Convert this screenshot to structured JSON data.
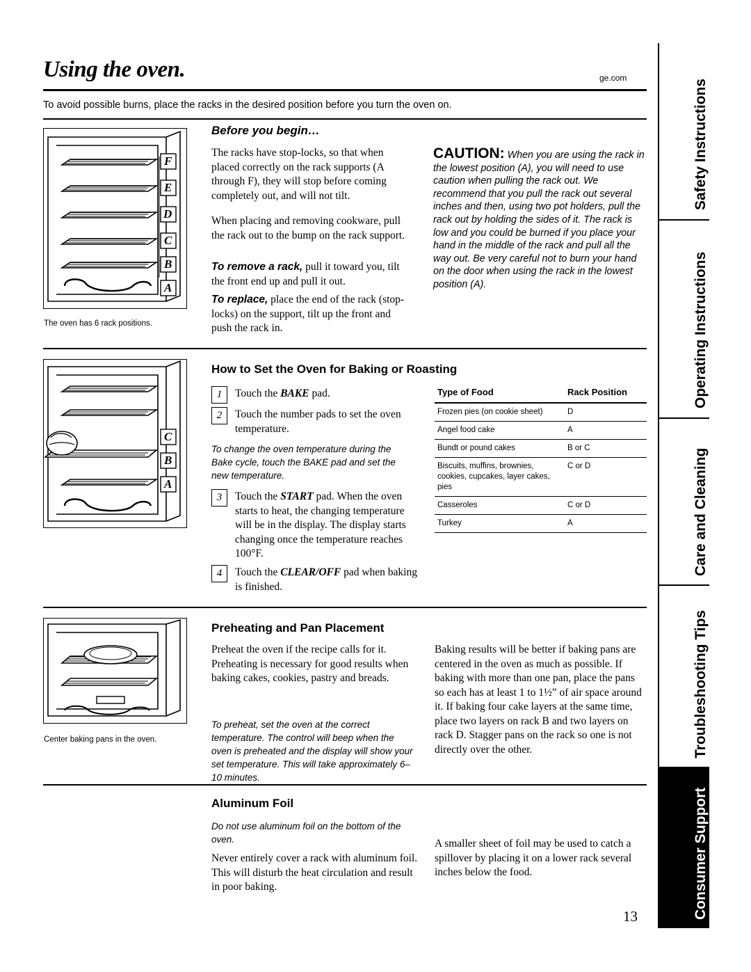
{
  "header": {
    "title": "Using the oven.",
    "url": "ge.com",
    "intro": "To avoid possible burns, place the racks in the desired position before you turn the oven on."
  },
  "sections": {
    "before_you_begin": {
      "heading": "Before you begin…",
      "p1": "The racks have stop-locks, so that when placed correctly on the rack supports (A through F), they will stop before coming completely out, and will not tilt.",
      "p2": "When placing and removing cookware, pull the rack out to the bump on the rack support.",
      "p3_lead": "To remove a rack,",
      "p3": " pull it toward you, tilt the front end up and pull it out.",
      "p4_lead": "To replace,",
      "p4": " place the end of the rack (stop-locks) on the support, tilt up the front and push the rack in."
    },
    "caution": {
      "label": "CAUTION:",
      "text": " When you are using the rack in the lowest position (A), you will need to use caution when pulling the rack out. We recommend that you pull the rack out several inches and then, using two pot holders, pull the rack out by holding the sides of it. The rack is low and you could be burned if you place your hand in the middle of the rack and pull all the way out. Be very careful not to burn your hand on the door when using the rack in the lowest position (A)."
    },
    "baking": {
      "heading": "How to Set the Oven for Baking or Roasting",
      "steps": [
        {
          "num": "1",
          "pre": "Touch the ",
          "pad": "BAKE",
          "post": " pad."
        },
        {
          "num": "2",
          "pre": "Touch the number pads to set the oven temperature.",
          "pad": "",
          "post": ""
        },
        {
          "num": "3",
          "pre": "Touch the ",
          "pad": "START",
          "post": " pad. When the oven starts to heat, the changing temperature will be in the display. The display starts changing once the temperature reaches 100°F."
        },
        {
          "num": "4",
          "pre": "Touch the ",
          "pad": "CLEAR/OFF",
          "post": " pad when baking is finished."
        }
      ],
      "note": "To change the oven temperature during the Bake cycle, touch the BAKE pad and set the new temperature."
    },
    "rack_table": {
      "headers": [
        "Type of Food",
        "Rack Position"
      ],
      "rows": [
        [
          "Frozen pies (on cookie sheet)",
          "D"
        ],
        [
          "Angel food cake",
          "A"
        ],
        [
          "Bundt or pound cakes",
          "B or C"
        ],
        [
          "Biscuits, muffins, brownies, cookies, cupcakes, layer cakes, pies",
          "C or D"
        ],
        [
          "Casseroles",
          "C or D"
        ],
        [
          "Turkey",
          "A"
        ]
      ]
    },
    "preheating": {
      "heading": "Preheating and Pan Placement",
      "p1": "Preheat the oven if the recipe calls for it. Preheating is necessary for good results when baking cakes, cookies, pastry and breads.",
      "note": "To preheat, set the oven at the correct temperature. The control will beep when the oven is preheated and the display will show your set temperature. This will take approximately 6–10 minutes.",
      "p2": "Baking results will be better if baking pans are centered in the oven as much as possible. If baking with more than one pan, place the pans so each has at least 1 to 1½” of air space around it. If baking four cake layers at the same time, place two layers on rack B and two layers on rack D. Stagger pans on the rack so one is not directly over the other."
    },
    "aluminum_foil": {
      "heading": "Aluminum Foil",
      "note": "Do not use aluminum foil on the bottom of the oven.",
      "p1": "Never entirely cover a rack with aluminum foil. This will disturb the heat circulation and result in poor baking.",
      "p2": "A smaller sheet of foil may be used to catch a spillover by placing it on a lower rack several inches below the food."
    }
  },
  "figures": {
    "fig1_caption": "The oven has 6 rack positions.",
    "fig1_labels": [
      "F",
      "E",
      "D",
      "C",
      "B",
      "A"
    ],
    "fig2_labels": [
      "C",
      "B",
      "A"
    ],
    "fig3_caption": "Center baking pans in the oven."
  },
  "sidebar": {
    "tabs": [
      {
        "label": "Safety Instructions",
        "inverted": false
      },
      {
        "label": "Operating Instructions",
        "inverted": false
      },
      {
        "label": "Care and Cleaning",
        "inverted": false
      },
      {
        "label": "Troubleshooting Tips",
        "inverted": false
      },
      {
        "label": "Consumer Support",
        "inverted": true
      }
    ]
  },
  "page_number": "13"
}
